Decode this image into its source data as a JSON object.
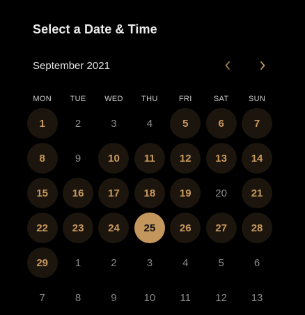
{
  "title": "Select a Date & Time",
  "calendar": {
    "month_label": "September 2021",
    "prev_icon": "chevron-left-icon",
    "next_icon": "chevron-right-icon",
    "accent_color": "#c3965e",
    "available_bg": "#1c150d",
    "weekdays": [
      "MON",
      "TUE",
      "WED",
      "THU",
      "FRI",
      "SAT",
      "SUN"
    ],
    "weeks": [
      [
        {
          "d": "1",
          "s": "available"
        },
        {
          "d": "2",
          "s": "unavailable"
        },
        {
          "d": "3",
          "s": "unavailable"
        },
        {
          "d": "4",
          "s": "unavailable"
        },
        {
          "d": "5",
          "s": "available"
        },
        {
          "d": "6",
          "s": "available"
        },
        {
          "d": "7",
          "s": "available"
        }
      ],
      [
        {
          "d": "8",
          "s": "available"
        },
        {
          "d": "9",
          "s": "unavailable"
        },
        {
          "d": "10",
          "s": "available"
        },
        {
          "d": "11",
          "s": "available"
        },
        {
          "d": "12",
          "s": "available"
        },
        {
          "d": "13",
          "s": "available"
        },
        {
          "d": "14",
          "s": "available"
        }
      ],
      [
        {
          "d": "15",
          "s": "available"
        },
        {
          "d": "16",
          "s": "available"
        },
        {
          "d": "17",
          "s": "available"
        },
        {
          "d": "18",
          "s": "available"
        },
        {
          "d": "19",
          "s": "available"
        },
        {
          "d": "20",
          "s": "unavailable"
        },
        {
          "d": "21",
          "s": "available"
        }
      ],
      [
        {
          "d": "22",
          "s": "available"
        },
        {
          "d": "23",
          "s": "available"
        },
        {
          "d": "24",
          "s": "available"
        },
        {
          "d": "25",
          "s": "selected"
        },
        {
          "d": "26",
          "s": "available"
        },
        {
          "d": "27",
          "s": "available"
        },
        {
          "d": "28",
          "s": "available"
        }
      ],
      [
        {
          "d": "29",
          "s": "available"
        },
        {
          "d": "1",
          "s": "other-month"
        },
        {
          "d": "2",
          "s": "other-month"
        },
        {
          "d": "3",
          "s": "other-month"
        },
        {
          "d": "4",
          "s": "other-month"
        },
        {
          "d": "5",
          "s": "other-month"
        },
        {
          "d": "6",
          "s": "other-month"
        }
      ],
      [
        {
          "d": "7",
          "s": "other-month"
        },
        {
          "d": "8",
          "s": "other-month"
        },
        {
          "d": "9",
          "s": "other-month"
        },
        {
          "d": "10",
          "s": "other-month"
        },
        {
          "d": "11",
          "s": "other-month"
        },
        {
          "d": "12",
          "s": "other-month"
        },
        {
          "d": "13",
          "s": "other-month"
        }
      ]
    ]
  }
}
